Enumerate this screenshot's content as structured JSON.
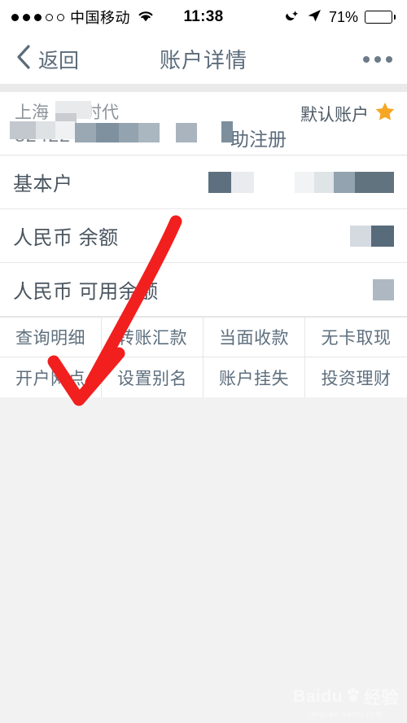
{
  "status_bar": {
    "signal_dots_filled": 3,
    "signal_dots_total": 5,
    "carrier": "中国移动",
    "wifi_icon": "wifi-icon",
    "time": "11:38",
    "alarm_icon": "alarm-icon",
    "location_icon": "location-arrow-icon",
    "battery_percent": "71%",
    "battery_level": 71
  },
  "nav": {
    "back_icon": "chevron-left-icon",
    "back_label": "返回",
    "title": "账户详情",
    "more_icon": "more-dots-icon"
  },
  "account": {
    "name_part1": "上海",
    "name_part2": "E时代",
    "number": "32422",
    "register_label": "助注册",
    "default_label": "默认账户",
    "star_icon": "star-icon",
    "star_color": "#f5a623"
  },
  "rows": [
    {
      "label": "基本户",
      "value": ""
    },
    {
      "label": "人民币 余额",
      "value": ""
    },
    {
      "label": "人民币 可用余额",
      "value": ""
    }
  ],
  "actions": [
    {
      "label": "查询明细"
    },
    {
      "label": "转账汇款"
    },
    {
      "label": "当面收款"
    },
    {
      "label": "无卡取现"
    },
    {
      "label": "开户网点"
    },
    {
      "label": "设置别名"
    },
    {
      "label": "账户挂失"
    },
    {
      "label": "投资理财"
    }
  ],
  "annotation": {
    "arrow_color": "#f21f1f",
    "points_to": "开户网点"
  },
  "watermark": {
    "brand": "Baidu",
    "suffix": "经验",
    "sub": "jingyan.baidu.com",
    "paw_icon": "paw-icon"
  },
  "colors": {
    "nav_text": "#5b6b7a",
    "row_text": "#4a5560",
    "button_text": "#5e6f7e",
    "page_bg": "#f2f2f2",
    "panel_bg": "#ffffff"
  }
}
